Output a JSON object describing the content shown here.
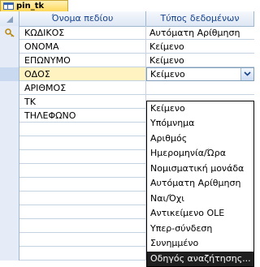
{
  "tab": {
    "title": "pin_tk"
  },
  "columns": {
    "field_name": "Όνομα πεδίου",
    "data_type": "Τύπος δεδομένων"
  },
  "rows": [
    {
      "name": "ΚΩΔΙΚΟΣ",
      "type": "Αυτόματη Αρίθμηση",
      "primary_key": true
    },
    {
      "name": "ΟΝΟΜΑ",
      "type": "Κείμενο"
    },
    {
      "name": "ΕΠΩΝΥΜΟ",
      "type": "Κείμενο"
    },
    {
      "name": "ΟΔΟΣ",
      "type": "Κείμενο",
      "active": true
    },
    {
      "name": "ΑΡΙΘΜΟΣ",
      "type": ""
    },
    {
      "name": "ΤΚ",
      "type": ""
    },
    {
      "name": "ΤΗΛΕΦΩΝΟ",
      "type": ""
    }
  ],
  "dropdown": {
    "selected": "Κείμενο",
    "options": [
      "Κείμενο",
      "Υπόμνημα",
      "Αριθμός",
      "Ημερομηνία/Ώρα",
      "Νομισματική μονάδα",
      "Αυτόματη Αρίθμηση",
      "Ναι/Όχι",
      "Αντικείμενο OLE",
      "Υπερ-σύνδεση",
      "Συνημμένο",
      "Οδηγός αναζήτησης..."
    ],
    "highlighted_index": 10
  },
  "colors": {
    "tab": "#ffd75a",
    "header_text": "#15428b",
    "active_row": "#fff3c2",
    "highlight": "#1f1f1f"
  }
}
